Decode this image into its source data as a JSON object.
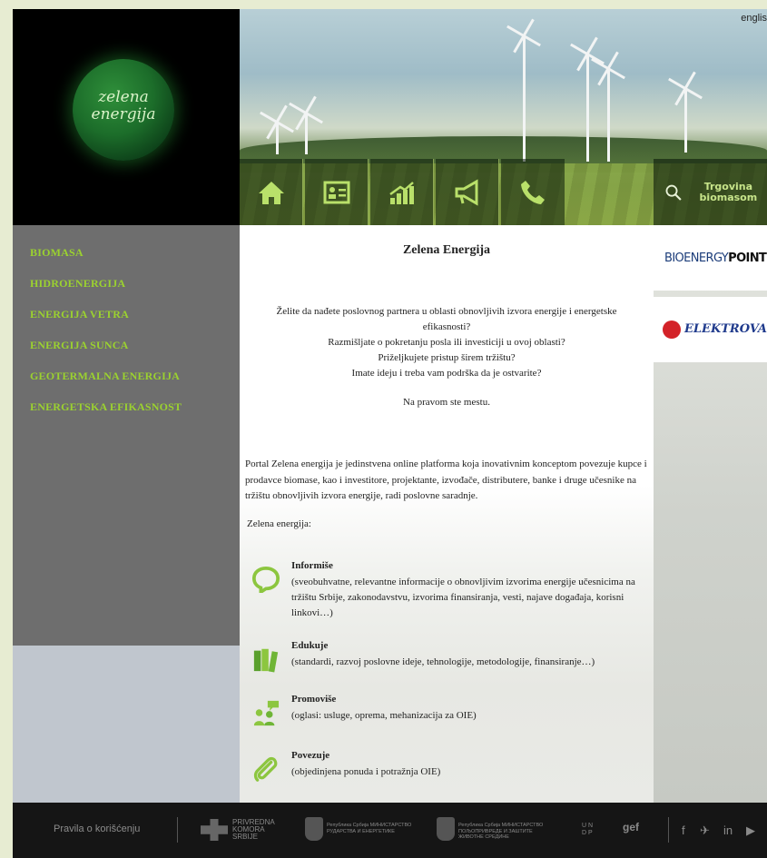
{
  "header": {
    "logo_text": "zelena energija",
    "language_link": "englis",
    "search_label": "Trgovina biomasom"
  },
  "nav": {
    "icons": [
      "home-icon",
      "profile-card-icon",
      "chart-growth-icon",
      "megaphone-icon",
      "phone-icon"
    ]
  },
  "sidebar": {
    "items": [
      {
        "label": "BIOMASA"
      },
      {
        "label": "HIDROENERGIJA"
      },
      {
        "label": "ENERGIJA VETRA"
      },
      {
        "label": "ENERGIJA SUNCA"
      },
      {
        "label": "GEOTERMALNA ENERGIJA"
      },
      {
        "label": "ENERGETSKA EFIKASNOST"
      }
    ]
  },
  "main": {
    "title": "Zelena Energija",
    "intro": [
      "Želite da nađete poslovnog partnera u oblasti obnovljivih izvora energije i energetske efikasnosti?",
      "Razmišljate o pokretanju posla ili investiciji u ovoj oblasti?",
      "Priželjkujete pristup širem tržištu?",
      "Imate ideju i treba vam  podrška da je ostvarite?"
    ],
    "right_place": "Na pravom ste mestu.",
    "portal_text": "Portal Zelena energija je jedinstvena online platforma koja inovativnim konceptom povezuje kupce i prodavce biomase, kao i investitore, projektante, izvođače, distributere, banke i druge učesnike na tržištu obnovljivih izvora energije, radi poslovne saradnje.",
    "ze_label": "Zelena energija:",
    "features": [
      {
        "title": "Informiše",
        "desc": "(sveobuhvatne, relevantne informacije o obnovljivim izvorima energije učesnicima na tržištu Srbije, zakonodavstvu, izvorima finansiranja, vesti, najave događaja, korisni linkovi…)",
        "icon": "speech-bubble-icon"
      },
      {
        "title": "Edukuje",
        "desc": "(standardi, razvoj poslovne ideje, tehnologije, metodologije, finansiranje…)",
        "icon": "books-icon"
      },
      {
        "title": "Promoviše",
        "desc": "(oglasi: usluge, oprema, mehanizacija za OIE)",
        "icon": "people-chat-icon"
      },
      {
        "title": "Povezuje",
        "desc": "(objedinjena ponuda i potražnja OIE)",
        "icon": "paperclip-icon"
      }
    ]
  },
  "sponsors": {
    "bioenergy_a": "BIOENERGY",
    "bioenergy_b": "POINT",
    "elektrovat": "ELEKTROVAT"
  },
  "footer": {
    "rules_link": "Pravila o korišćenju",
    "pk_text": "PRIVREDNA KOMORA SRBIJE",
    "ministry1": "Република Србија МИНИСТАРСТВО РУДАРСТВА И ЕНЕРГЕТИКЕ",
    "ministry2": "Република Србија МИНИСТАРСТВО ПОЉОПРИВРЕДЕ И ЗАШТИТЕ ЖИВОТНЕ СРЕДИНЕ",
    "undp": "U N D P",
    "gef": "gef",
    "social_icons": [
      "facebook-icon",
      "twitter-icon",
      "linkedin-icon",
      "youtube-icon"
    ]
  },
  "colors": {
    "accent_green": "#9bd22f",
    "sidebar_bg": "#6e6e6e",
    "page_bg": "#e7ecd2"
  }
}
